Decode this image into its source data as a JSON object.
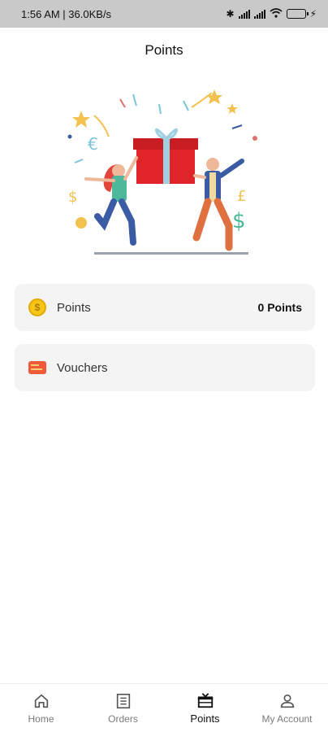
{
  "status_bar": {
    "time_speed": "1:56 AM | 36.0KB/s",
    "battery_level": 0.7
  },
  "header": {
    "title": "Points"
  },
  "cards": {
    "points": {
      "label": "Points",
      "value": "0 Points",
      "icon": "coin-icon"
    },
    "vouchers": {
      "label": "Vouchers",
      "icon": "voucher-icon"
    }
  },
  "bottom_nav": {
    "items": [
      {
        "label": "Home",
        "icon": "home-icon"
      },
      {
        "label": "Orders",
        "icon": "orders-icon"
      },
      {
        "label": "Points",
        "icon": "gift-icon",
        "active": true
      },
      {
        "label": "My Account",
        "icon": "account-icon"
      }
    ]
  },
  "colors": {
    "status_bar": "#c9c9c9",
    "card_bg": "#f4f4f4",
    "gift_red": "#e0252a",
    "coin": "#f5c518",
    "voucher": "#ef5a3a"
  }
}
